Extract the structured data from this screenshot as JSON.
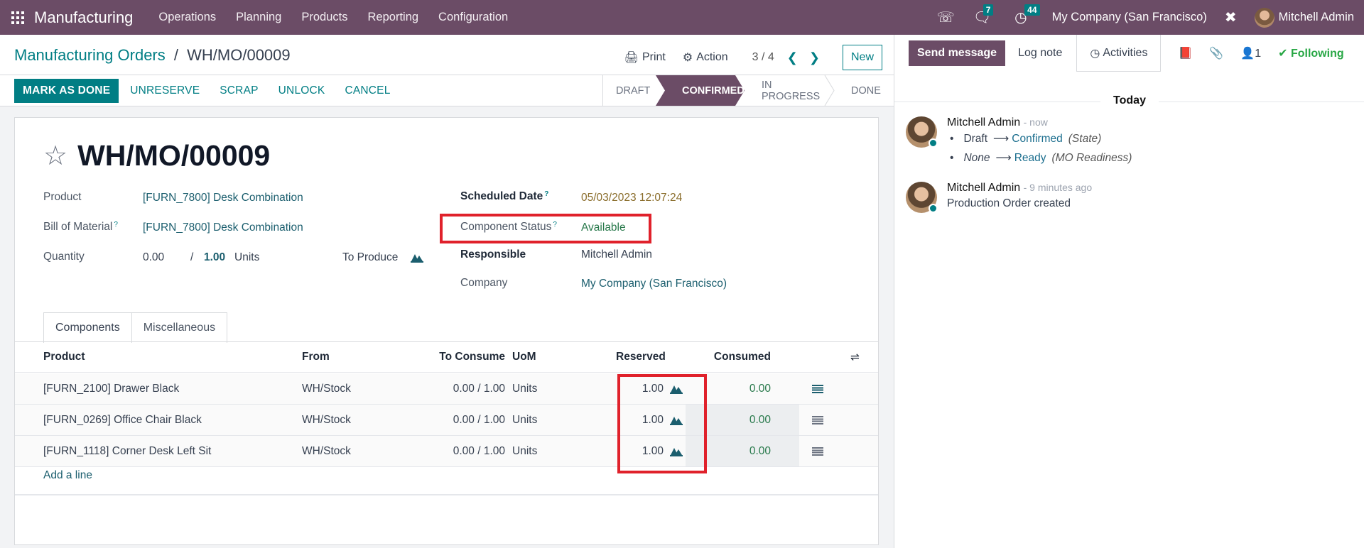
{
  "navbar": {
    "app_name": "Manufacturing",
    "menu": [
      "Operations",
      "Planning",
      "Products",
      "Reporting",
      "Configuration"
    ],
    "messages_badge": "7",
    "activities_badge": "44",
    "company": "My Company (San Francisco)",
    "user": "Mitchell Admin"
  },
  "breadcrumb": {
    "parent": "Manufacturing Orders",
    "separator": "/",
    "current": "WH/MO/00009"
  },
  "control": {
    "print_label": "Print",
    "action_label": "Action",
    "pager": "3 / 4",
    "new_label": "New"
  },
  "actions": [
    "MARK AS DONE",
    "UNRESERVE",
    "SCRAP",
    "UNLOCK",
    "CANCEL"
  ],
  "statusbar": {
    "stages": [
      "DRAFT",
      "CONFIRMED",
      "IN PROGRESS",
      "DONE"
    ],
    "active": "CONFIRMED"
  },
  "form": {
    "title": "WH/MO/00009",
    "product_label": "Product",
    "product_value": "[FURN_7800] Desk Combination",
    "bom_label": "Bill of Material",
    "bom_value": "[FURN_7800] Desk Combination",
    "quantity_label": "Quantity",
    "quantity_done": "0.00",
    "quantity_sep": "/",
    "quantity_total": "1.00",
    "quantity_uom": "Units",
    "to_produce_label": "To Produce",
    "scheduled_date_label": "Scheduled Date",
    "scheduled_date_value": "05/03/2023 12:07:24",
    "component_status_label": "Component Status",
    "component_status_value": "Available",
    "responsible_label": "Responsible",
    "responsible_value": "Mitchell Admin",
    "company_label": "Company",
    "company_value": "My Company (San Francisco)",
    "help_mark": "?"
  },
  "tabs": [
    "Components",
    "Miscellaneous"
  ],
  "components": {
    "columns": [
      "Product",
      "From",
      "To Consume",
      "UoM",
      "Reserved",
      "Consumed"
    ],
    "rows": [
      {
        "product": "[FURN_2100] Drawer Black",
        "from": "WH/Stock",
        "to_consume": "0.00 /  1.00",
        "uom": "Units",
        "reserved": "1.00",
        "consumed": "0.00"
      },
      {
        "product": "[FURN_0269] Office Chair Black",
        "from": "WH/Stock",
        "to_consume": "0.00 /  1.00",
        "uom": "Units",
        "reserved": "1.00",
        "consumed": "0.00"
      },
      {
        "product": "[FURN_1118] Corner Desk Left Sit",
        "from": "WH/Stock",
        "to_consume": "0.00 /  1.00",
        "uom": "Units",
        "reserved": "1.00",
        "consumed": "0.00"
      }
    ],
    "add_line": "Add a line"
  },
  "chatter": {
    "send_message": "Send message",
    "log_note": "Log note",
    "activities": "Activities",
    "followers_count": "1",
    "following": "Following",
    "date_separator": "Today",
    "messages": [
      {
        "author": "Mitchell Admin",
        "time": "- now",
        "tracking": [
          {
            "from": "Draft",
            "to": "Confirmed",
            "field": "(State)"
          },
          {
            "from": "None",
            "to": "Ready",
            "field": "(MO Readiness)"
          }
        ]
      },
      {
        "author": "Mitchell Admin",
        "time": "- 9 minutes ago",
        "body": "Production Order created"
      }
    ]
  }
}
